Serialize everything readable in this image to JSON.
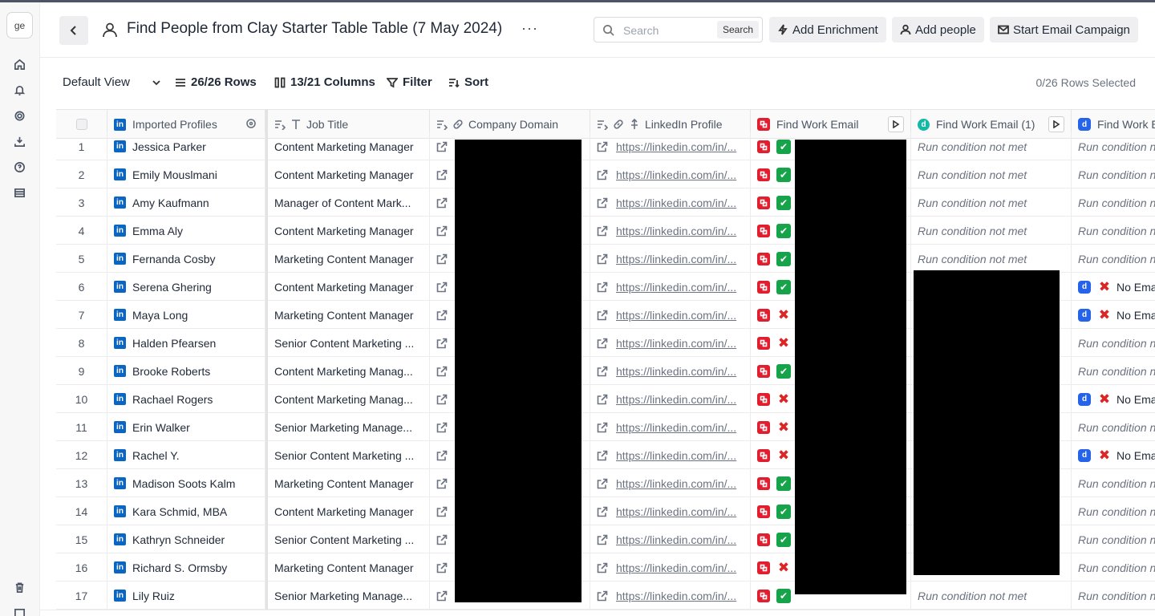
{
  "workspace": {
    "badge": "ge"
  },
  "header": {
    "title": "Find People from Clay Starter Table Table (7 May 2024)",
    "more": "···",
    "search_placeholder": "Search",
    "search_button": "Search",
    "add_enrichment": "Add Enrichment",
    "add_people": "Add people",
    "start_campaign": "Start Email Campaign"
  },
  "toolbar": {
    "view": "Default View",
    "rows": "26/26 Rows",
    "columns": "13/21 Columns",
    "filter": "Filter",
    "sort": "Sort",
    "selected": "0/26 Rows Selected"
  },
  "columns": {
    "imported_profiles": "Imported Profiles",
    "job_title": "Job Title",
    "company_domain": "Company Domain",
    "linkedin_profile": "LinkedIn Profile",
    "find_work_email": "Find Work Email",
    "find_work_email_1": "Find Work Email (1)",
    "find_work_email_2": "Find Work E"
  },
  "texts": {
    "run_condition": "Run condition not met",
    "no_email": "No Ema",
    "linkedin_url": "https://linkedin.com/in/..."
  },
  "rows": [
    {
      "n": "1",
      "name": "Jessica Parker",
      "job": "Content Marketing Manager",
      "email_status": "ok",
      "em1": "run",
      "em2": "run"
    },
    {
      "n": "2",
      "name": "Emily Mouslmani",
      "job": "Content Marketing Manager",
      "email_status": "ok",
      "em1": "run",
      "em2": "run"
    },
    {
      "n": "3",
      "name": "Amy Kaufmann",
      "job": "Manager of Content Mark...",
      "email_status": "ok",
      "em1": "run",
      "em2": "run"
    },
    {
      "n": "4",
      "name": "Emma Aly",
      "job": "Content Marketing Manager",
      "email_status": "ok",
      "em1": "run",
      "em2": "run"
    },
    {
      "n": "5",
      "name": "Fernanda Cosby",
      "job": "Marketing Content Manager",
      "email_status": "ok",
      "em1": "run",
      "em2": "run"
    },
    {
      "n": "6",
      "name": "Serena Ghering",
      "job": "Content Marketing Manager",
      "email_status": "ok",
      "em1": "redacted",
      "em2": "noemail"
    },
    {
      "n": "7",
      "name": "Maya Long",
      "job": "Marketing Content Manager",
      "email_status": "no",
      "em1": "redacted",
      "em2": "noemail"
    },
    {
      "n": "8",
      "name": "Halden Pfearsen",
      "job": "Senior Content Marketing ...",
      "email_status": "no",
      "em1": "redacted",
      "em2": "run"
    },
    {
      "n": "9",
      "name": "Brooke Roberts",
      "job": "Content Marketing Manag...",
      "email_status": "ok",
      "em1": "redacted",
      "em2": "run"
    },
    {
      "n": "10",
      "name": "Rachael Rogers",
      "job": "Content Marketing Manag...",
      "email_status": "no",
      "em1": "redacted",
      "em2": "noemail"
    },
    {
      "n": "11",
      "name": "Erin Walker",
      "job": "Senior Marketing Manage...",
      "email_status": "no",
      "em1": "redacted",
      "em2": "run"
    },
    {
      "n": "12",
      "name": "Rachel Y.",
      "job": "Senior Content Marketing ...",
      "email_status": "no",
      "em1": "redacted",
      "em2": "noemail"
    },
    {
      "n": "13",
      "name": "Madison Soots Kalm",
      "job": "Marketing Content Manager",
      "email_status": "ok",
      "em1": "redacted",
      "em2": "run"
    },
    {
      "n": "14",
      "name": "Kara Schmid, MBA",
      "job": "Content Marketing Manager",
      "email_status": "ok",
      "em1": "redacted",
      "em2": "run"
    },
    {
      "n": "15",
      "name": "Kathryn Schneider",
      "job": "Senior Content Marketing ...",
      "email_status": "ok",
      "em1": "redacted",
      "em2": "run"
    },
    {
      "n": "16",
      "name": "Richard S. Ormsby",
      "job": "Marketing Content Manager",
      "email_status": "no",
      "em1": "redacted",
      "em2": "run"
    },
    {
      "n": "17",
      "name": "Lily Ruiz",
      "job": "Senior Marketing Manage...",
      "email_status": "ok",
      "em1": "run",
      "em2": "run"
    }
  ],
  "colors": {
    "linkedin": "#0a66c2",
    "ok": "#16a34a",
    "no": "#dc2626",
    "redaction": "#000000"
  }
}
